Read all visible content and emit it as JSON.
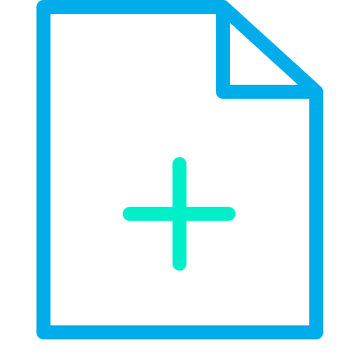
{
  "icon": {
    "name": "new-file-icon",
    "document_name": "document-outline",
    "fold_name": "folded-corner",
    "plus_name": "plus-icon",
    "colors": {
      "outline": "#00ACEA",
      "plus": "#00EFC8",
      "background": "#FFFFFF"
    }
  }
}
